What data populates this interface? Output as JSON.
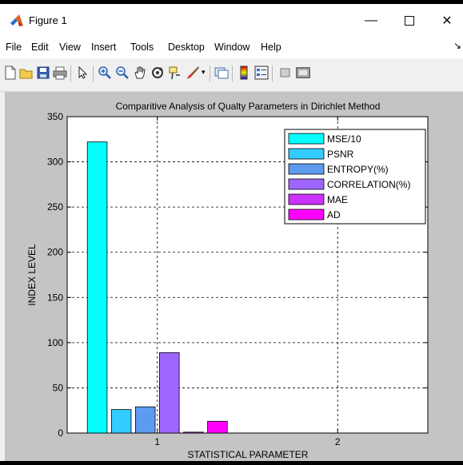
{
  "window": {
    "title": "Figure 1",
    "minimize_icon": "minimize-icon",
    "maximize_icon": "maximize-icon",
    "close_icon": "close-icon"
  },
  "menu": {
    "items": [
      "File",
      "Edit",
      "View",
      "Insert",
      "Tools",
      "Desktop",
      "Window",
      "Help"
    ]
  },
  "toolbar": {
    "icons": [
      "new-figure-icon",
      "open-file-icon",
      "save-icon",
      "print-icon",
      "pointer-icon",
      "zoom-in-icon",
      "zoom-out-icon",
      "pan-icon",
      "rotate-icon",
      "data-cursor-icon",
      "brush-icon",
      "link-plot-icon",
      "colorbar-icon",
      "legend-icon",
      "hide-plot-tools-icon",
      "show-plot-tools-icon"
    ]
  },
  "chart_data": {
    "type": "bar",
    "title": "Comparitive Analysis of Qualty Parameters in Dirichlet Method",
    "xlabel": "STATISTICAL PARAMETER",
    "ylabel": "INDEX LEVEL",
    "categories": [
      "1",
      "2"
    ],
    "xlim": [
      0.5,
      2.5
    ],
    "ylim": [
      0,
      350
    ],
    "yticks": [
      "0",
      "50",
      "100",
      "150",
      "200",
      "250",
      "300",
      "350"
    ],
    "grid": true,
    "legend_position": "top-right",
    "series": [
      {
        "name": "MSE/10",
        "values": [
          322,
          0
        ],
        "color": "#00ffff"
      },
      {
        "name": "PSNR",
        "values": [
          26,
          0
        ],
        "color": "#33ccff"
      },
      {
        "name": "ENTROPY(%)",
        "values": [
          29,
          0
        ],
        "color": "#5c9bf0"
      },
      {
        "name": "CORRELATION(%)",
        "values": [
          89,
          0
        ],
        "color": "#9e66ff"
      },
      {
        "name": "MAE",
        "values": [
          1,
          0
        ],
        "color": "#cc33ff"
      },
      {
        "name": "AD",
        "values": [
          13,
          0
        ],
        "color": "#ff00ff"
      }
    ]
  }
}
